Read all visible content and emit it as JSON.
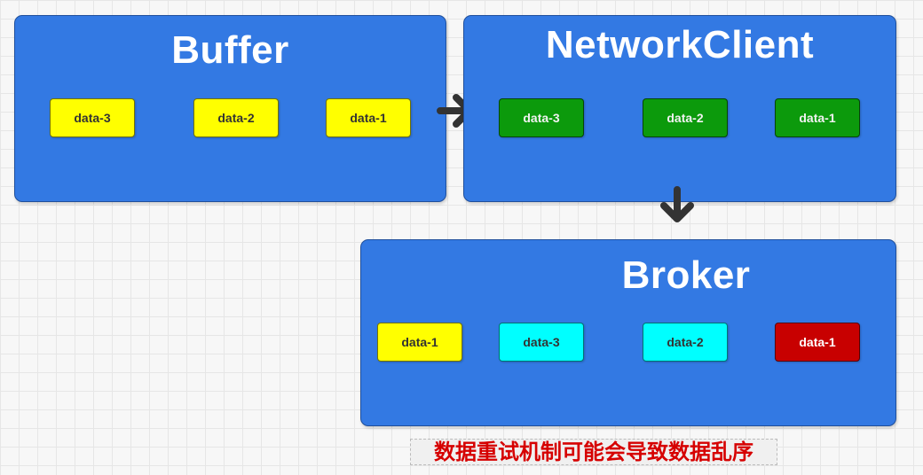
{
  "panels": {
    "buffer": {
      "title": "Buffer",
      "chips": [
        "data-3",
        "data-2",
        "data-1"
      ]
    },
    "network_client": {
      "title": "NetworkClient",
      "chips": [
        "data-3",
        "data-2",
        "data-1"
      ]
    },
    "broker": {
      "title": "Broker",
      "chips": [
        "data-1",
        "data-3",
        "data-2",
        "data-1"
      ]
    }
  },
  "caption": "数据重试机制可能会导致数据乱序",
  "colors": {
    "panel": "#3379e3",
    "yellow_chip": "#ffff00",
    "green_chip": "#0c9a0c",
    "cyan_chip": "#00ffff",
    "red_chip": "#c80000",
    "caption_text": "#d60000",
    "arrow": "#333333"
  },
  "icons": [
    "arrow-right-icon",
    "arrow-down-icon"
  ]
}
